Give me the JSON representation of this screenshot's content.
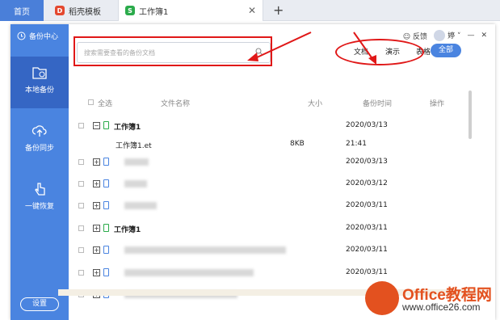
{
  "browser": {
    "tabs": [
      {
        "label": "首页"
      },
      {
        "label": "稻壳模板"
      },
      {
        "label": "工作簿1"
      }
    ]
  },
  "window": {
    "title": "备份中心",
    "feedback": "反馈",
    "username": "婷",
    "sidebar": [
      {
        "label": "本地备份"
      },
      {
        "label": "备份同步"
      },
      {
        "label": "一键恢复"
      }
    ],
    "settings": "设置"
  },
  "search": {
    "placeholder": "搜索需要查看的备份文档"
  },
  "filters": [
    "文档",
    "演示",
    "表格"
  ],
  "all_label": "全部",
  "columns": {
    "select_all": "全选",
    "file_name": "文件名称",
    "size": "大小",
    "backup_time": "备份时间",
    "action": "操作"
  },
  "rows": [
    {
      "name": "工作簿1",
      "date": "2020/03/13",
      "icon_color": "#2bab4b"
    },
    {
      "name": "工作簿1.et",
      "size": "8KB",
      "time": "21:41"
    },
    {
      "name": "",
      "date": "2020/03/13",
      "icon_color": "#4a84e0"
    },
    {
      "name": "",
      "date": "2020/03/12",
      "icon_color": "#4a84e0"
    },
    {
      "name": "",
      "date": "2020/03/11",
      "icon_color": "#4a84e0"
    },
    {
      "name": "工作簿1",
      "date": "2020/03/11",
      "icon_color": "#2bab4b"
    },
    {
      "name": "",
      "date": "2020/03/11",
      "icon_color": "#4a84e0"
    },
    {
      "name": "",
      "date": "2020/03/11",
      "icon_color": "#4a84e0"
    },
    {
      "name": "",
      "date": "202",
      "icon_color": "#4a84e0"
    }
  ],
  "watermark": {
    "brand": "Office教程网",
    "url": "www.office26.com"
  },
  "colors": {
    "accent": "#4a84e0",
    "annotation": "#e01818"
  }
}
